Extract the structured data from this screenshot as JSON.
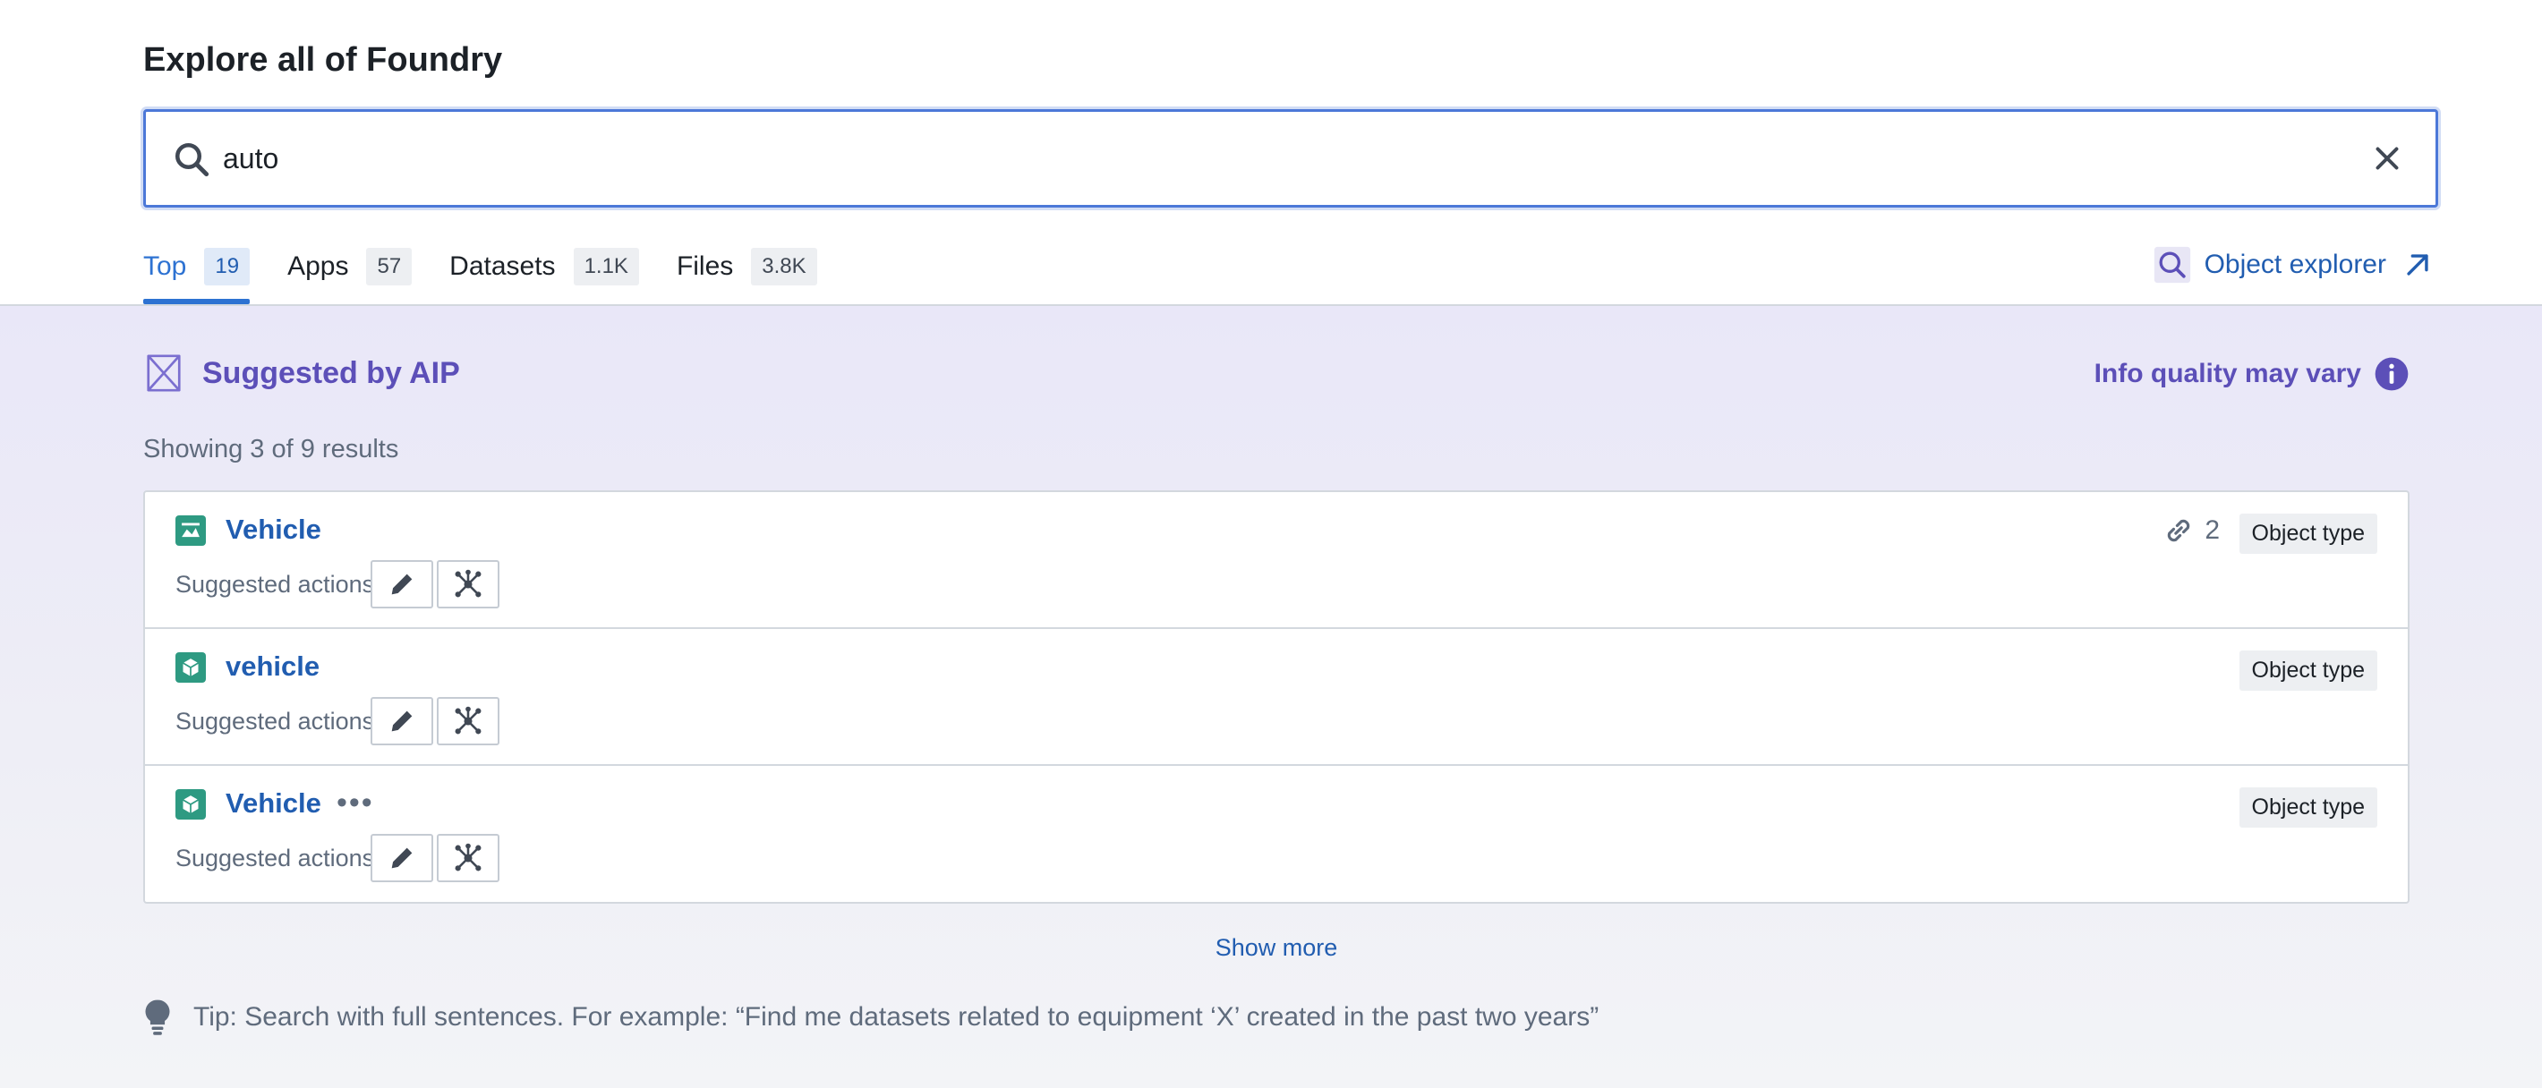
{
  "header": {
    "title": "Explore all of Foundry"
  },
  "search": {
    "value": "auto",
    "placeholder": ""
  },
  "tabs": [
    {
      "label": "Top",
      "count": "19",
      "active": true
    },
    {
      "label": "Apps",
      "count": "57"
    },
    {
      "label": "Datasets",
      "count": "1.1K"
    },
    {
      "label": "Files",
      "count": "3.8K"
    }
  ],
  "object_explorer": {
    "label": "Object explorer"
  },
  "aip": {
    "title": "Suggested by AIP",
    "quality_note": "Info quality may vary",
    "showing": "Showing 3 of 9 results",
    "results": [
      {
        "name": "Vehicle",
        "links": "2",
        "type": "Object type",
        "actions_label": "Suggested actions:"
      },
      {
        "name": "vehicle",
        "type": "Object type",
        "actions_label": "Suggested actions:"
      },
      {
        "name": "Vehicle",
        "more": "•••",
        "type": "Object type",
        "actions_label": "Suggested actions:"
      }
    ],
    "show_more": "Show more",
    "tip": "Tip: Search with full sentences. For example: “Find me datasets related to equipment ‘X’ created in the past two years”"
  },
  "colors": {
    "accent": "#2d72d2",
    "aip_purple": "#5c4fb8",
    "object_icon": "#2e9a82"
  }
}
